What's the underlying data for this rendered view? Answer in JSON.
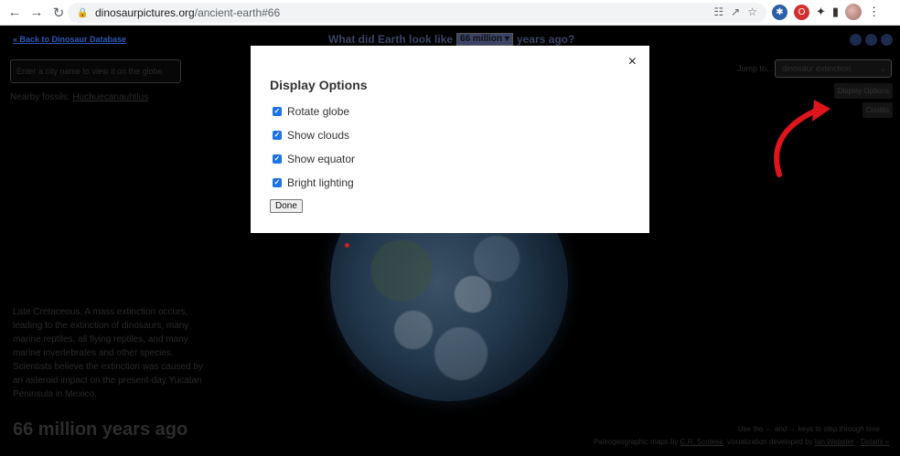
{
  "browser": {
    "url_domain": "dinosaurpictures.org",
    "url_path": "/ancient-earth#66"
  },
  "header": {
    "back_link": "« Back to Dinosaur Database",
    "title_prefix": "What did Earth look like",
    "era_selected": "66 million",
    "title_suffix": "years ago?"
  },
  "left": {
    "city_placeholder": "Enter a city name to view it on the globe",
    "nearby_label": "Nearby fossils:",
    "nearby_fossil": "Huchuecanauhtlus",
    "description": "Late Cretaceous. A mass extinction occurs, leading to the extinction of dinosaurs, many marine reptiles, all flying reptiles, and many marine invertebrates and other species. Scientists believe the extinction was caused by an asteroid impact on the present-day Yucatan Peninsula in Mexico.",
    "age_label": "66 million years ago"
  },
  "right": {
    "jump_label": "Jump to...",
    "jump_selected": "dinosaur extinction",
    "display_options_button": "Display Options",
    "credits_button": "Credits"
  },
  "footer": {
    "hint": "Use the ← and → keys to step through time",
    "credits_prefix": "Paleogeographic maps by",
    "credits_author": "C.R. Scotese",
    "credits_mid": ", visualization developed by",
    "credits_dev": "Ian Webster",
    "details_link": "Details »"
  },
  "modal": {
    "title": "Display Options",
    "close": "×",
    "options": [
      {
        "label": "Rotate globe",
        "checked": true
      },
      {
        "label": "Show clouds",
        "checked": true
      },
      {
        "label": "Show equator",
        "checked": true
      },
      {
        "label": "Bright lighting",
        "checked": true
      }
    ],
    "done_label": "Done"
  },
  "colors": {
    "annotation_arrow": "#e0151b",
    "checkbox": "#1a73e8"
  }
}
